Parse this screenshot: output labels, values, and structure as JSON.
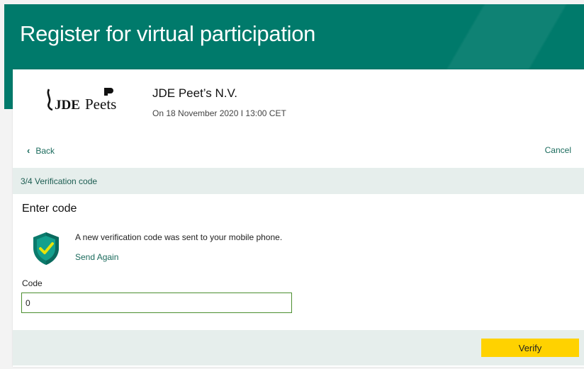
{
  "header": {
    "title": "Register for virtual participation",
    "accent": "#007a6b"
  },
  "company": {
    "logo_text": "JDE Peet's",
    "name": "JDE Peet’s N.V.",
    "date": "On 18 November 2020 I 13:00 CET"
  },
  "nav": {
    "back_label": "Back",
    "back_icon": "chevron-left-icon",
    "cancel_label": "Cancel"
  },
  "step": {
    "label": "3/4 Verification code"
  },
  "verification": {
    "title": "Enter code",
    "icon": "shield-check-icon",
    "message": "A new verification code was sent to your mobile phone.",
    "send_again_label": "Send Again",
    "code_label": "Code",
    "code_value": "0"
  },
  "footer": {
    "verify_label": "Verify",
    "verify_color": "#ffd200"
  }
}
